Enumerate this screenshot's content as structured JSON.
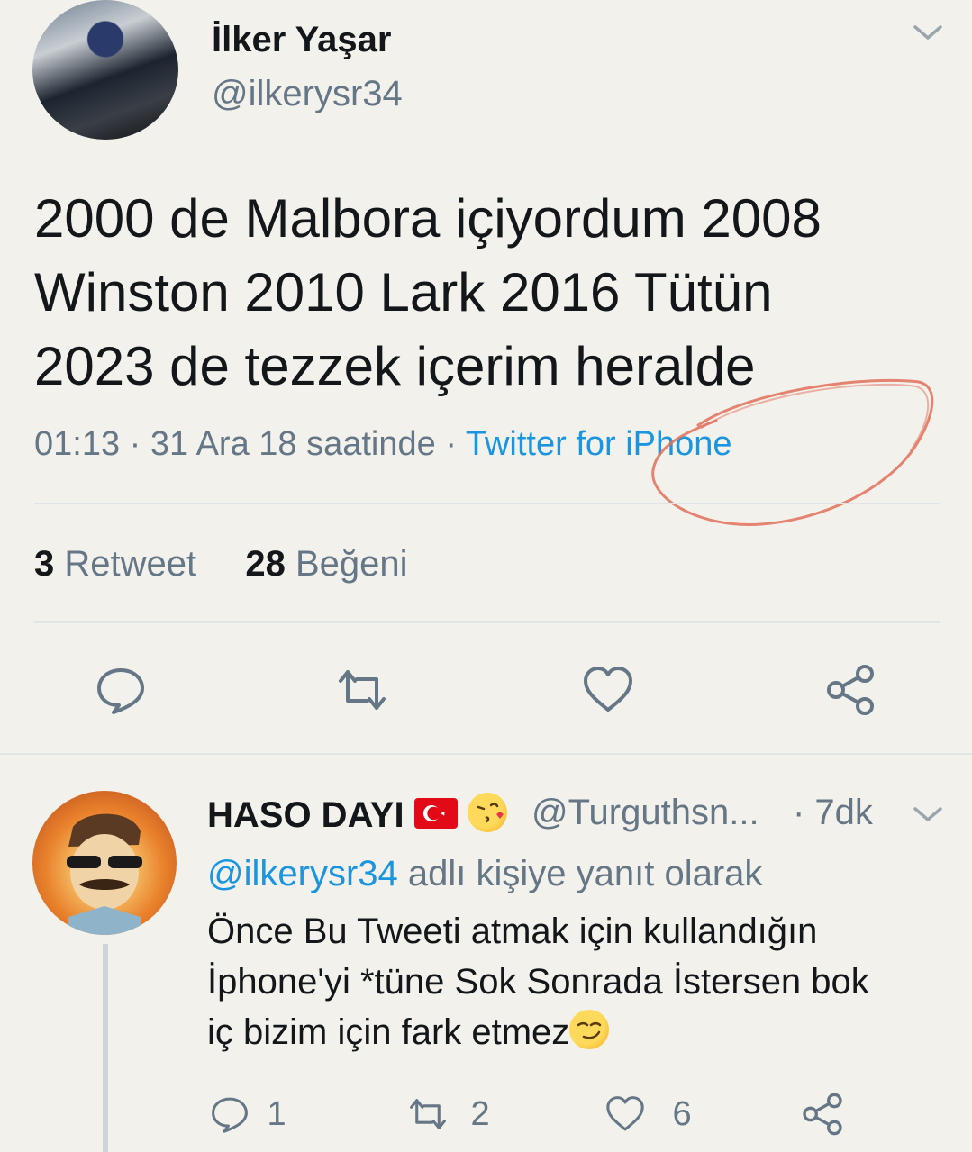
{
  "tweet": {
    "author_name": "İlker Yaşar",
    "author_handle": "@ilkerysr34",
    "text_lines": [
      "2000 de Malbora içiyordum 2008",
      "Winston 2010 Lark 2016 Tütün",
      "2023 de tezzek içerim heralde"
    ],
    "timestamp": "01:13 · 31 Ara 18 saatinde · ",
    "source": "Twitter for iPhone",
    "retweet_count": "3",
    "retweet_label": "Retweet",
    "like_count": "28",
    "like_label": "Beğeni",
    "chevron_icon": "chevron-down-icon",
    "actions": [
      "reply-icon",
      "retweet-icon",
      "like-icon",
      "share-icon"
    ]
  },
  "reply": {
    "author_name": "HASO DAYI",
    "author_handle": "@Turguthsn...",
    "time": "· 7dk",
    "reply_prefix_mention": "@ilkerysr34",
    "reply_prefix_text": " adlı kişiye yanıt olarak",
    "text_lines": [
      "Önce Bu Tweeti atmak için kullandığın",
      "İphone'yi *tüne Sok Sonrada İstersen bok",
      "iç bizim için fark etmez"
    ],
    "reply_count": "1",
    "retweet_count": "2",
    "like_count": "6"
  },
  "colors": {
    "background": "#f3f1ec",
    "text": "#14171a",
    "muted": "#657786",
    "link": "#1b95e0",
    "annotation": "#e0705a"
  }
}
